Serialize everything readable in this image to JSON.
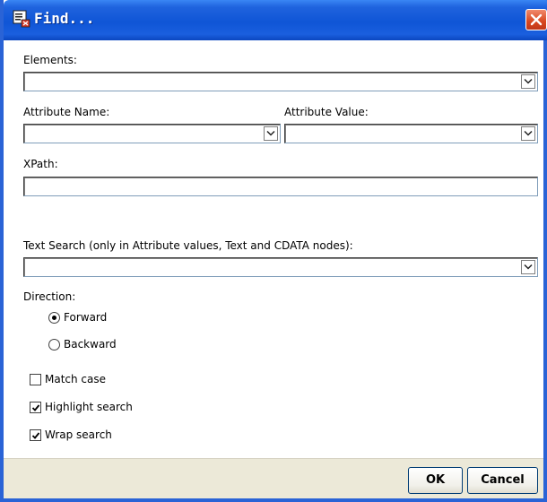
{
  "window": {
    "title": "Find...",
    "accent_color": "#1f63de",
    "close_icon": "close-icon"
  },
  "form": {
    "elements_label": "Elements:",
    "elements_value": "",
    "attribute_name_label": "Attribute Name:",
    "attribute_name_value": "",
    "attribute_value_label": "Attribute Value:",
    "attribute_value_value": "",
    "xpath_label": "XPath:",
    "xpath_value": "",
    "text_search_label": "Text Search (only in Attribute values, Text and CDATA nodes):",
    "text_search_value": ""
  },
  "direction": {
    "label": "Direction:",
    "options": [
      {
        "label": "Forward",
        "selected": true
      },
      {
        "label": "Backward",
        "selected": false
      }
    ]
  },
  "options": [
    {
      "label": "Match case",
      "checked": false
    },
    {
      "label": "Highlight search",
      "checked": true
    },
    {
      "label": "Wrap search",
      "checked": true
    }
  ],
  "buttons": {
    "ok": "OK",
    "cancel": "Cancel"
  }
}
